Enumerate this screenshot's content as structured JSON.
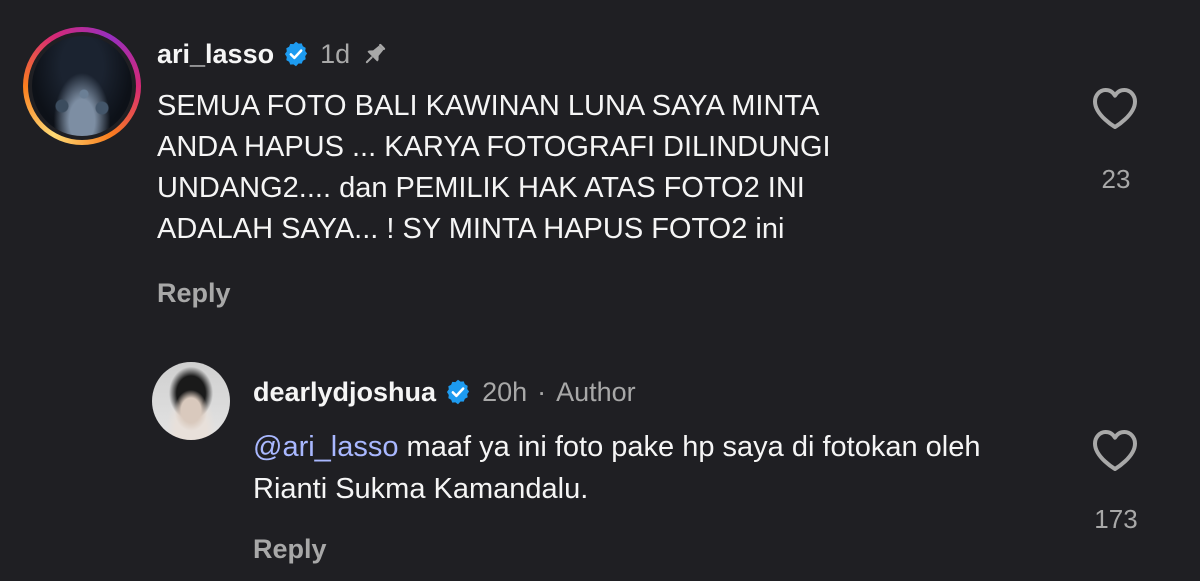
{
  "comments": [
    {
      "username": "ari_lasso",
      "time": "1d",
      "text": "SEMUA FOTO BALI KAWINAN LUNA SAYA MINTA\nANDA HAPUS ... KARYA FOTOGRAFI DILINDUNGI\nUNDANG2.... dan PEMILIK HAK ATAS FOTO2 INI\nADALAH SAYA... ! SY MINTA HAPUS FOTO2 ini",
      "reply_label": "Reply",
      "like_count": "23",
      "pinned": true,
      "verified": true
    },
    {
      "username": "dearlydjoshua",
      "time": "20h",
      "separator": "·",
      "badge": "Author",
      "mention": "@ari_lasso",
      "text": " maaf ya ini foto pake hp saya di fotokan oleh Rianti Sukma Kamandalu.",
      "reply_label": "Reply",
      "like_count": "173",
      "verified": true
    }
  ],
  "colors": {
    "background": "#1f1f23",
    "text": "#f5f5f5",
    "muted": "#a8a8a8",
    "verified": "#1d9bf0",
    "mention": "#a9b8ff"
  },
  "icons": [
    "verified-badge-icon",
    "pin-icon",
    "heart-icon"
  ]
}
